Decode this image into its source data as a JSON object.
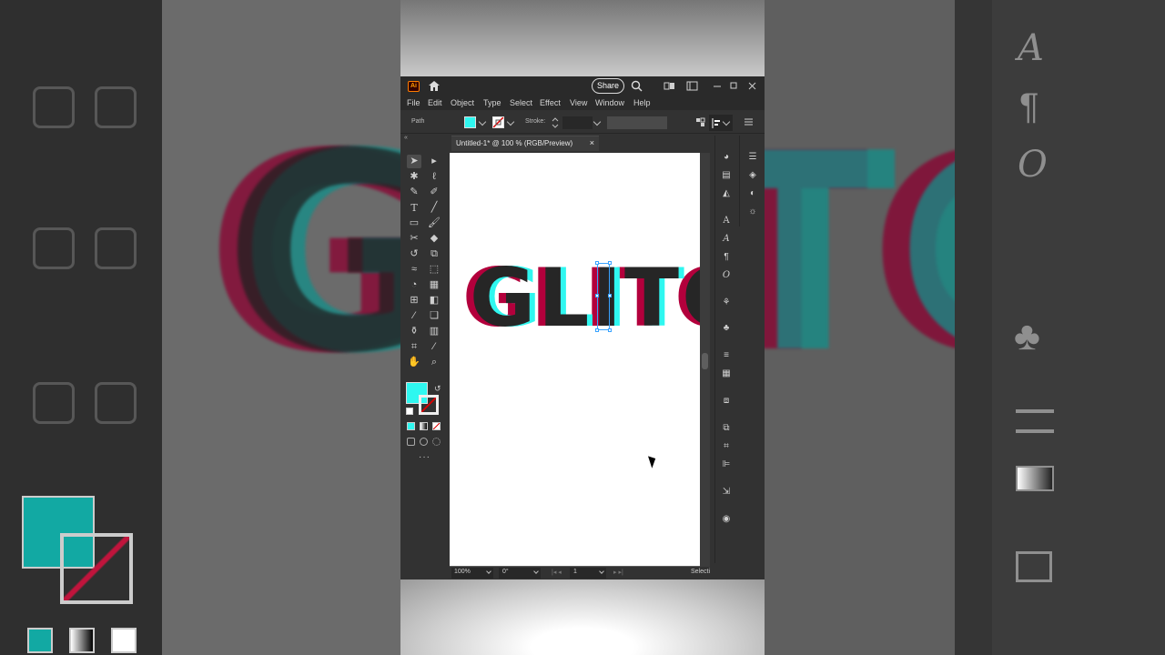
{
  "app": {
    "logo": "Ai",
    "share_label": "Share",
    "menu": [
      "File",
      "Edit",
      "Object",
      "Type",
      "Select",
      "Effect",
      "View",
      "Window",
      "Help"
    ]
  },
  "control": {
    "selection_label": "Path",
    "stroke_label": "Stroke:",
    "fill_color": "#2ff7f0"
  },
  "document": {
    "tab_label": "Untitled-1* @ 100 % (RGB/Preview)",
    "close_glyph": "×"
  },
  "artwork": {
    "text": "GLITC",
    "colors": {
      "red": "#b3003c",
      "cyan": "#2ff7f0",
      "dark": "#262626"
    }
  },
  "status": {
    "zoom": "100%",
    "rotation": "0°",
    "artboard": "1",
    "tool": "Selecti"
  },
  "background": {
    "glyphs_left": "GL",
    "glyphs_right": "TC",
    "panel_icons": [
      "A",
      "¶",
      "O",
      "♣"
    ]
  },
  "colors": {
    "fill": "#2ff7f0",
    "bg_fill": "#12a9a3"
  }
}
